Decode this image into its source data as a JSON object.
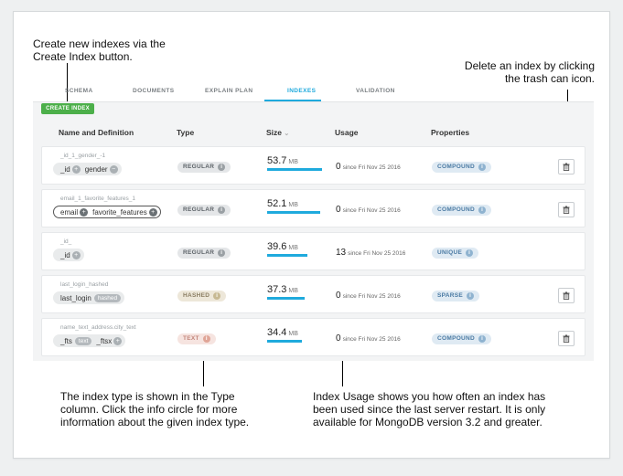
{
  "callouts": {
    "create": "Create new indexes via the Create Index button.",
    "delete": "Delete an index by clicking the trash can icon.",
    "type": "The index type is shown in the Type column. Click the info circle for more information about the given index type.",
    "usage": "Index Usage shows you how often an index has been used since the last server restart. It is only available for MongoDB version 3.2 and greater."
  },
  "tabs": [
    "SCHEMA",
    "DOCUMENTS",
    "EXPLAIN PLAN",
    "INDEXES",
    "VALIDATION"
  ],
  "active_tab": "INDEXES",
  "toolbar": {
    "create_label": "CREATE INDEX"
  },
  "table": {
    "headers": {
      "name": "Name and Definition",
      "type": "Type",
      "size": "Size",
      "size_sort": "⌄",
      "usage": "Usage",
      "properties": "Properties"
    },
    "rows": [
      {
        "name": "_id_1_gender_-1",
        "fields": [
          "_id",
          "gender"
        ],
        "type": "REGULAR",
        "size": "53.7",
        "unit": "MB",
        "size_fraction": 1.0,
        "usage_count": "0",
        "usage_since": "since Fri Nov 25 2016",
        "property": "COMPOUND",
        "deletable": true
      },
      {
        "name": "email_1_favorite_features_1",
        "fields": [
          "email",
          "favorite_features"
        ],
        "type": "REGULAR",
        "size": "52.1",
        "unit": "MB",
        "size_fraction": 0.97,
        "usage_count": "0",
        "usage_since": "since Fri Nov 25 2016",
        "property": "COMPOUND",
        "deletable": true
      },
      {
        "name": "_id_",
        "fields": [
          "_id"
        ],
        "type": "REGULAR",
        "size": "39.6",
        "unit": "MB",
        "size_fraction": 0.74,
        "usage_count": "13",
        "usage_since": "since Fri Nov 25 2016",
        "property": "UNIQUE",
        "deletable": false
      },
      {
        "name": "last_login_hashed",
        "fields": [
          "last_login"
        ],
        "field_tag": "hashed",
        "type": "HASHED",
        "size": "37.3",
        "unit": "MB",
        "size_fraction": 0.69,
        "usage_count": "0",
        "usage_since": "since Fri Nov 25 2016",
        "property": "SPARSE",
        "deletable": true
      },
      {
        "name": "name_text_address.city_text",
        "fields": [
          "_fts",
          "_ftsx"
        ],
        "field_tag": "text",
        "type": "TEXT",
        "size": "34.4",
        "unit": "MB",
        "size_fraction": 0.64,
        "usage_count": "0",
        "usage_since": "since Fri Nov 25 2016",
        "property": "COMPOUND",
        "deletable": true
      }
    ]
  },
  "colors": {
    "accent": "#1faadd",
    "create_button": "#4caf4a",
    "property_badge": "#dfeaf3"
  },
  "icons": {
    "field_add": "plus-circle-icon",
    "info": "info-circle-icon",
    "delete": "trash-icon"
  }
}
